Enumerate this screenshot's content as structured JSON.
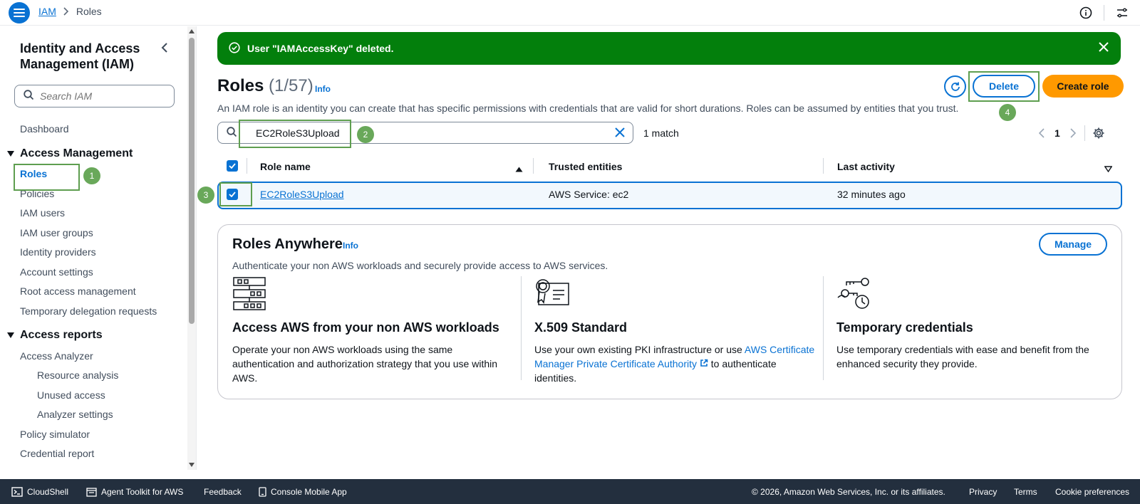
{
  "breadcrumb": {
    "root": "IAM",
    "current": "Roles"
  },
  "sidebar": {
    "title": "Identity and Access Management (IAM)",
    "search_placeholder": "Search IAM",
    "dashboard": "Dashboard",
    "section_access_management": "Access Management",
    "items_access_management": [
      "Roles",
      "Policies",
      "IAM users",
      "IAM user groups",
      "Identity providers",
      "Account settings",
      "Root access management",
      "Temporary delegation requests"
    ],
    "section_access_reports": "Access reports",
    "access_analyzer": "Access Analyzer",
    "analyzer_sub": [
      "Resource analysis",
      "Unused access",
      "Analyzer settings"
    ],
    "items_reports": [
      "Policy simulator",
      "Credential report"
    ]
  },
  "flash": {
    "message": "User \"IAMAccessKey\" deleted."
  },
  "header": {
    "title": "Roles",
    "count": "(1/57)",
    "info": "Info",
    "description": "An IAM role is an identity you can create that has specific permissions with credentials that are valid for short durations. Roles can be assumed by entities that you trust.",
    "delete_label": "Delete",
    "create_label": "Create role"
  },
  "filter": {
    "value": "EC2RoleS3Upload",
    "match_text": "1 match"
  },
  "pagination": {
    "page": "1"
  },
  "table": {
    "columns": [
      "Role name",
      "Trusted entities",
      "Last activity"
    ],
    "rows": [
      {
        "role_name": "EC2RoleS3Upload",
        "trusted_entities": "AWS Service: ec2",
        "last_activity": "32 minutes ago",
        "selected": true
      }
    ]
  },
  "roles_anywhere": {
    "title": "Roles Anywhere",
    "info": "Info",
    "manage_label": "Manage",
    "description": "Authenticate your non AWS workloads and securely provide access to AWS services.",
    "col1": {
      "title": "Access AWS from your non AWS workloads",
      "text": "Operate your non AWS workloads using the same authentication and authorization strategy that you use within AWS."
    },
    "col2": {
      "title": "X.509 Standard",
      "text_before": "Use your own existing PKI infrastructure or use ",
      "link": "AWS Certificate Manager Private Certificate Authority",
      "text_after": " to authenticate identities."
    },
    "col3": {
      "title": "Temporary credentials",
      "text": "Use temporary credentials with ease and benefit from the enhanced security they provide."
    }
  },
  "annotations": [
    "1",
    "2",
    "3",
    "4"
  ],
  "footer": {
    "cloudshell": "CloudShell",
    "agent_toolkit": "Agent Toolkit for AWS",
    "feedback": "Feedback",
    "mobile_app": "Console Mobile App",
    "copyright": "© 2026, Amazon Web Services, Inc. or its affiliates.",
    "privacy": "Privacy",
    "terms": "Terms",
    "cookies": "Cookie preferences"
  },
  "colors": {
    "accent": "#0972d3",
    "success": "#037f0c",
    "primary_button": "#ff9900",
    "footer_bg": "#232f3e",
    "annotation": "#5e9e4f"
  }
}
